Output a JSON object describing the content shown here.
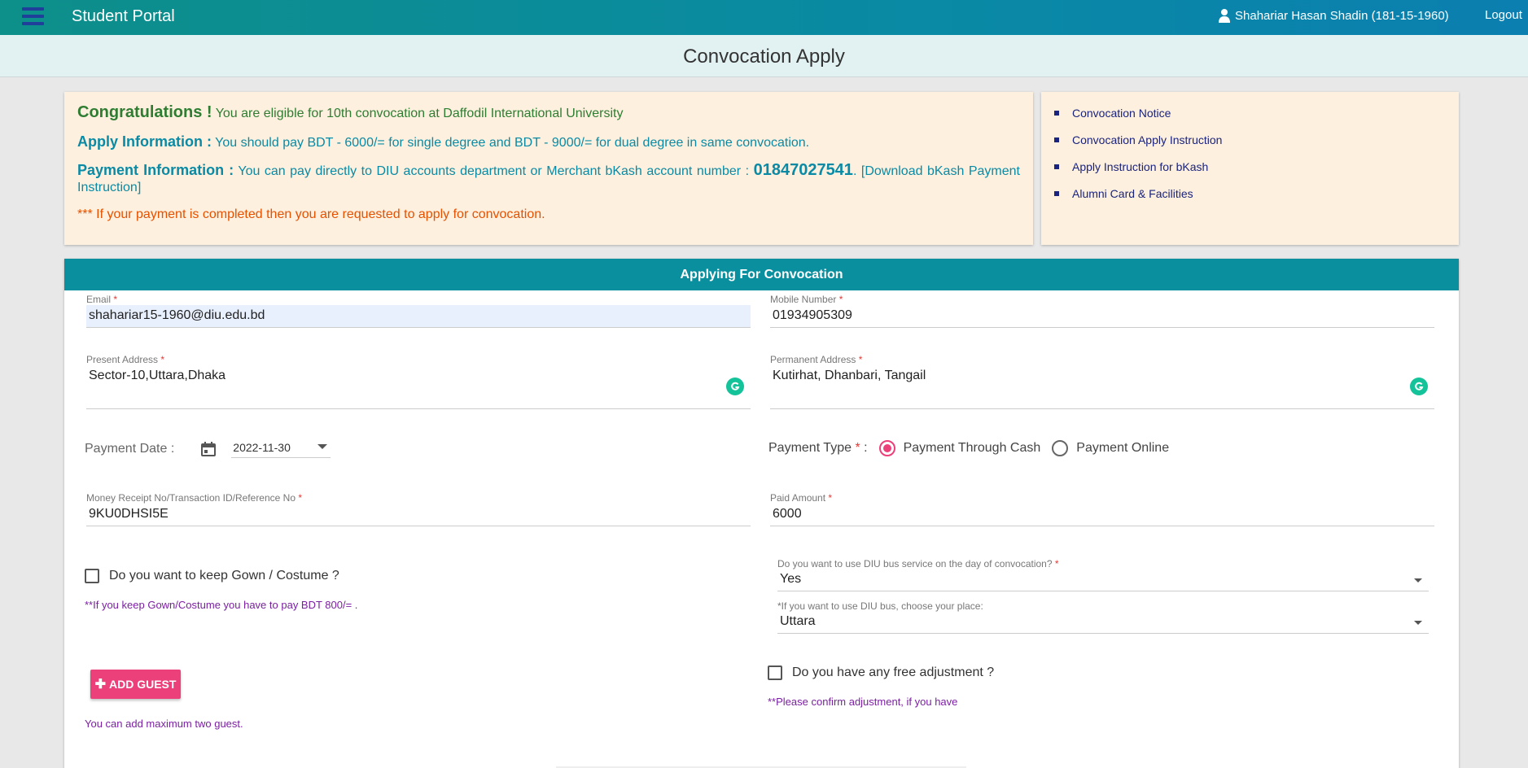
{
  "header": {
    "brand": "Student Portal",
    "user": "Shahariar Hasan Shadin (181-15-1960)",
    "logout": "Logout"
  },
  "page_title": "Convocation Apply",
  "notice": {
    "congrats_title": "Congratulations !",
    "congrats_text": "You are eligible for 10th convocation at Daffodil International University",
    "apply_title": "Apply Information :",
    "apply_text": "You should pay BDT - 6000/= for single degree and BDT - 9000/= for dual degree in same convocation.",
    "payment_title": "Payment Information :",
    "payment_text": "You can pay directly to DIU accounts department or Merchant bKash account number :",
    "payment_phone": "01847027541",
    "payment_link": ". [Download bKash Payment Instruction]",
    "warning": "*** If your payment is completed then you are requested to apply for convocation."
  },
  "links": [
    "Convocation Notice",
    "Convocation Apply Instruction",
    "Apply Instruction for bKash",
    "Alumni Card & Facilities"
  ],
  "form": {
    "heading": "Applying For Convocation",
    "email_label": "Email",
    "email_value": "shahariar15-1960@diu.edu.bd",
    "mobile_label": "Mobile Number",
    "mobile_value": "01934905309",
    "present_label": "Present Address",
    "present_value": "Sector-10,Uttara,Dhaka",
    "permanent_label": "Permanent Address",
    "permanent_value": "Kutirhat, Dhanbari, Tangail",
    "payment_date_label": "Payment Date :",
    "payment_date_value": "2022-11-30",
    "payment_type_label": "Payment Type",
    "payment_type_options": [
      "Payment Through Cash",
      "Payment Online"
    ],
    "payment_type_selected": "Payment Through Cash",
    "receipt_label": "Money Receipt No/Transaction ID/Reference No",
    "receipt_value": "9KU0DHSI5E",
    "paid_label": "Paid Amount",
    "paid_value": "6000",
    "gown_label": "Do you want to keep Gown / Costume ?",
    "gown_note": "**If you keep Gown/Costume you have to pay BDT 800/= .",
    "bus_label": "Do you want to use DIU bus service on the day of convocation?",
    "bus_value": "Yes",
    "bus_place_label": "*If you want to use DIU bus, choose your place:",
    "bus_place_value": "Uttara",
    "adjust_label": "Do you have any free adjustment ?",
    "adjust_note": "**Please confirm adjustment, if you have",
    "add_guest": "ADD GUEST",
    "guest_note": "You can add maximum two guest.",
    "required_mark": "*",
    "colon": ":"
  },
  "colors": {
    "header_teal": "#0a8aa4",
    "accent_pink": "#ec407a",
    "notice_bg": "#fdf0df"
  }
}
